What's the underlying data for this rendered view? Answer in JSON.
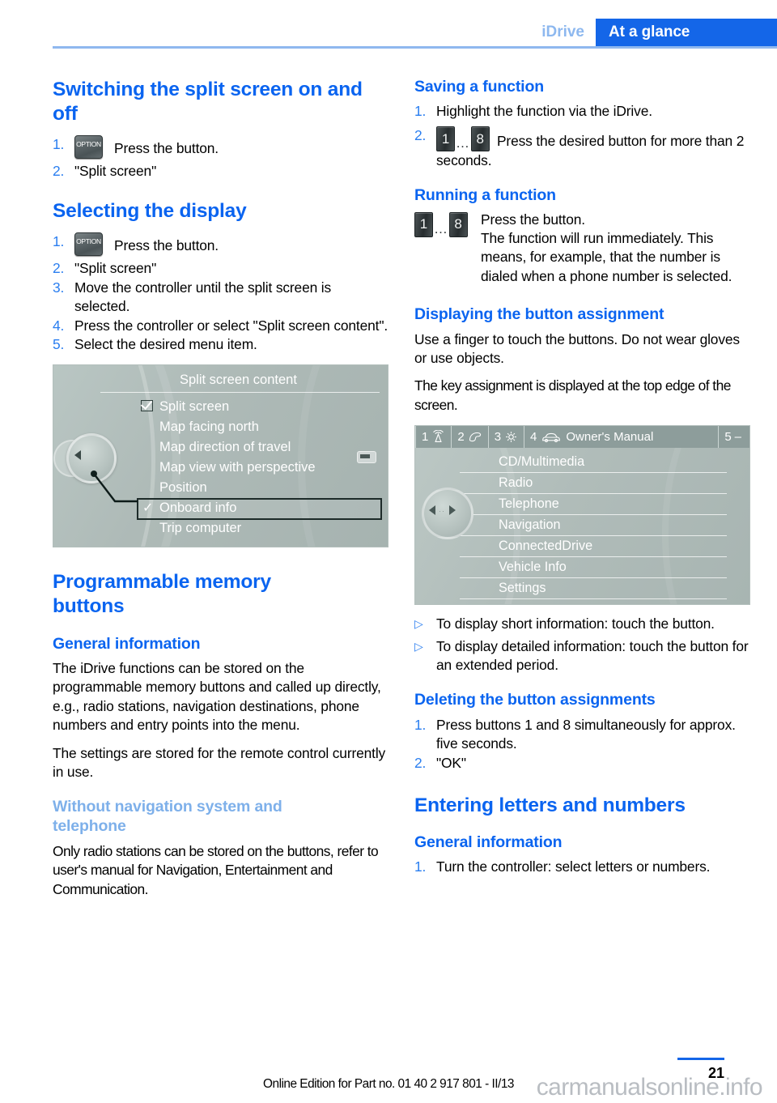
{
  "header": {
    "chapter": "iDrive",
    "section": "At a glance"
  },
  "left_column": {
    "section1": {
      "title": "Switching the split screen on and off",
      "steps": [
        {
          "num": "1.",
          "icon": "option-button",
          "icon_label": "OPTION",
          "text": "Press the button."
        },
        {
          "num": "2.",
          "text": "\"Split screen\""
        }
      ]
    },
    "section2": {
      "title": "Selecting the display",
      "steps": [
        {
          "num": "1.",
          "icon": "option-button",
          "icon_label": "OPTION",
          "text": "Press the button."
        },
        {
          "num": "2.",
          "text": "\"Split screen\""
        },
        {
          "num": "3.",
          "text": "Move the controller until the split screen is selected."
        },
        {
          "num": "4.",
          "text": "Press the controller or select \"Split screen content\"."
        },
        {
          "num": "5.",
          "text": "Select the desired menu item."
        }
      ]
    },
    "screen1": {
      "title": "Split screen content",
      "items": [
        {
          "label": "Split screen",
          "mark": "checkbox-checked"
        },
        {
          "label": "Map facing north",
          "mark": "none"
        },
        {
          "label": "Map direction of travel",
          "mark": "none"
        },
        {
          "label": "Map view with perspective",
          "mark": "none"
        },
        {
          "label": "Position",
          "mark": "none"
        },
        {
          "label": "Onboard info",
          "mark": "check",
          "highlighted": true
        },
        {
          "label": "Trip computer",
          "mark": "none"
        }
      ]
    },
    "section3": {
      "title": "Programmable memory buttons",
      "sub1_title": "General information",
      "sub1_paras": [
        "The iDrive functions can be stored on the programmable memory buttons and called up directly, e.g., radio stations, navigation destinations, phone numbers and entry points into the menu.",
        "The settings are stored for the remote control currently in use."
      ],
      "sub2_title": "Without navigation system and telephone",
      "sub2_paras": [
        "Only radio stations can be stored on the buttons, refer to user's manual for Navigation, Entertainment and Communication."
      ]
    }
  },
  "right_column": {
    "section1": {
      "title": "Saving a function",
      "steps": [
        {
          "num": "1.",
          "text": "Highlight the function via the iDrive."
        },
        {
          "num": "2.",
          "icon": "number-buttons",
          "btn_from": "1",
          "btn_to": "8",
          "dots": "…",
          "text": "Press the desired button for more than 2 seconds."
        }
      ]
    },
    "section2": {
      "title": "Running a function",
      "btn_from": "1",
      "btn_to": "8",
      "dots": "…",
      "line1": "Press the button.",
      "line2": "The function will run immediately. This means, for example, that the number is dialed when a phone number is selected."
    },
    "section3": {
      "title": "Displaying the button assignment",
      "paras": [
        "Use a finger to touch the buttons. Do not wear gloves or use objects.",
        "The key assignment is displayed at the top edge of the screen."
      ]
    },
    "screen2": {
      "topbar": [
        {
          "num": "1",
          "icon": "antenna-icon"
        },
        {
          "num": "2",
          "icon": "phone-icon"
        },
        {
          "num": "3",
          "icon": "gear-icon"
        },
        {
          "num": "4",
          "icon": "car-icon",
          "label": "Owner's Manual"
        },
        {
          "num": "5",
          "icon": "dash-icon",
          "label": "–"
        }
      ],
      "items": [
        "CD/Multimedia",
        "Radio",
        "Telephone",
        "Navigation",
        "ConnectedDrive",
        "Vehicle Info",
        "Settings"
      ]
    },
    "bullets": [
      {
        "bullet": "▷",
        "text": "To display short information: touch the button."
      },
      {
        "bullet": "▷",
        "text": "To display detailed information: touch the button for an extended period."
      }
    ],
    "section4": {
      "title": "Deleting the button assignments",
      "steps": [
        {
          "num": "1.",
          "text": "Press buttons 1 and 8 simultaneously for approx. five seconds."
        },
        {
          "num": "2.",
          "text": "\"OK\""
        }
      ]
    },
    "section5": {
      "title": "Entering letters and numbers",
      "sub_title": "General information",
      "steps": [
        {
          "num": "1.",
          "text": "Turn the controller: select letters or numbers."
        }
      ]
    }
  },
  "footer": {
    "edition": "Online Edition for Part no. 01 40 2 917 801 - II/13",
    "page_number": "21",
    "watermark": "carmanualsonline.info"
  },
  "colors": {
    "accent_blue": "#0a64f0",
    "tab_blue": "#1466e8",
    "light_blue": "#8db8ef",
    "screen_bg": "#aebab7"
  }
}
